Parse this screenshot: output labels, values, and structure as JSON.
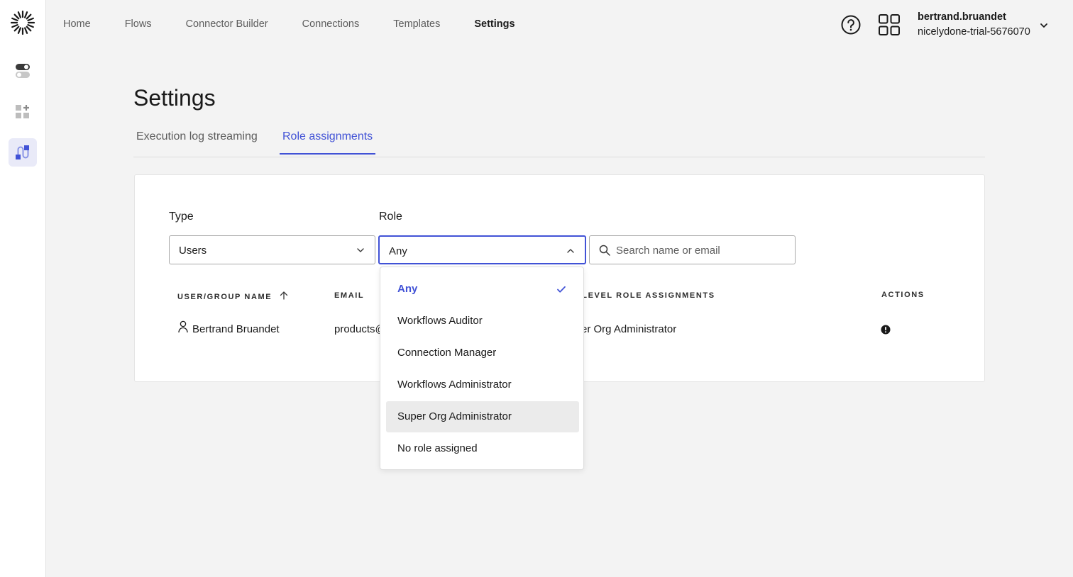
{
  "nav": {
    "links": [
      "Home",
      "Flows",
      "Connector Builder",
      "Connections",
      "Templates",
      "Settings"
    ],
    "current": "Settings"
  },
  "account": {
    "username": "bertrand.bruandet",
    "org": "nicelydone-trial-5676070"
  },
  "page": {
    "title": "Settings",
    "tabs": [
      "Execution log streaming",
      "Role assignments"
    ],
    "active_tab": "Role assignments"
  },
  "filters": {
    "type_label": "Type",
    "type_value": "Users",
    "role_label": "Role",
    "role_value": "Any",
    "search_placeholder": "Search name or email"
  },
  "table": {
    "headers": [
      "USER/GROUP NAME",
      "EMAIL",
      "-LEVEL ROLE ASSIGNMENTS",
      "ACTIONS"
    ],
    "rows": [
      {
        "name": "Bertrand Bruandet",
        "email": "products@",
        "role": "er Org Administrator"
      }
    ]
  },
  "role_menu": {
    "options": [
      "Any",
      "Workflows Auditor",
      "Connection Manager",
      "Workflows Administrator",
      "Super Org Administrator",
      "No role assigned"
    ],
    "selected": "Any",
    "hovered": "Super Org Administrator"
  },
  "colors": {
    "accent": "#4152d6",
    "rail_active": "#e9eaf8",
    "background": "#f3f3f3"
  }
}
